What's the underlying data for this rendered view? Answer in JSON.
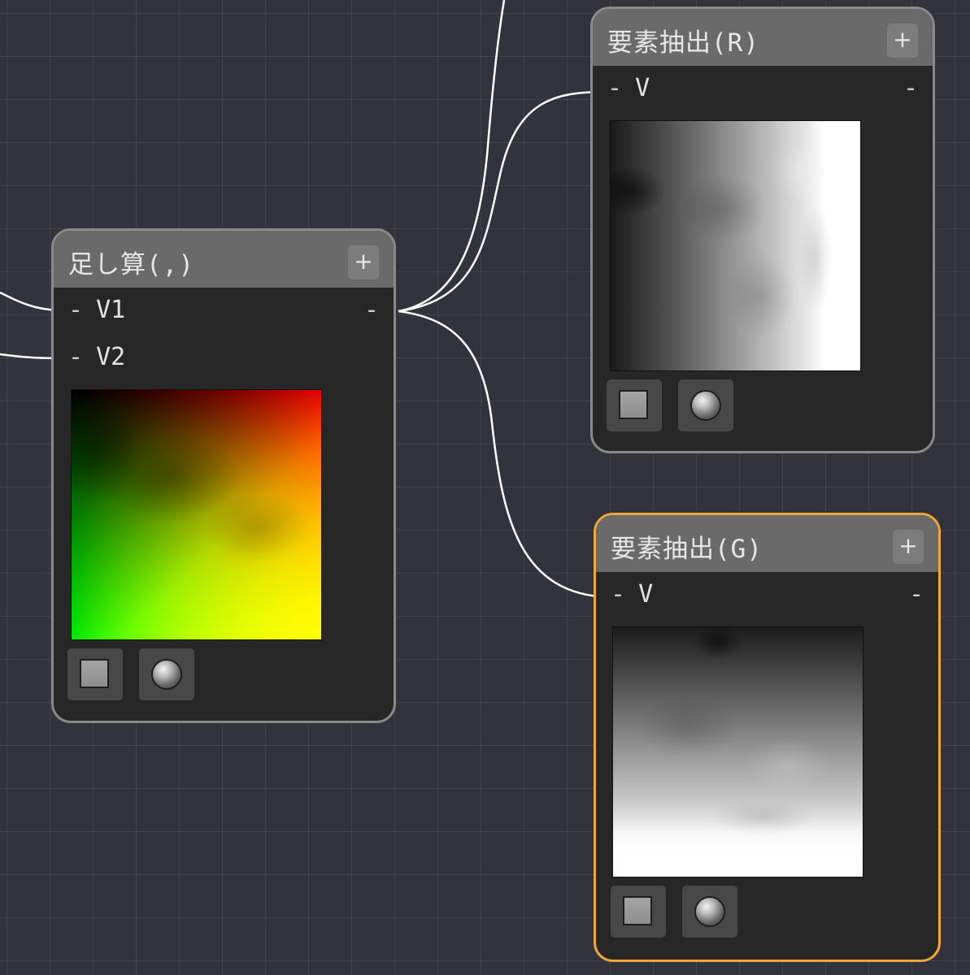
{
  "nodes": {
    "add": {
      "title": "足し算(,)",
      "add_label": "+",
      "inputs": [
        {
          "dash": "-",
          "label": "V1"
        },
        {
          "dash": "-",
          "label": "V2"
        }
      ],
      "output_dash": "-"
    },
    "extract_r": {
      "title": "要素抽出(R)",
      "add_label": "+",
      "input": {
        "dash": "-",
        "label": "V"
      },
      "output_dash": "-"
    },
    "extract_g": {
      "title": "要素抽出(G)",
      "add_label": "+",
      "input": {
        "dash": "-",
        "label": "V"
      },
      "output_dash": "-",
      "selected": true
    }
  },
  "colors": {
    "canvas_bg": "#33333d",
    "node_bg": "#272727",
    "header_bg": "#6a6a6a",
    "selection": "#f0a83a",
    "wire": "#ffffff"
  },
  "icons": {
    "preview_plane": "square-icon",
    "preview_sphere": "sphere-icon",
    "add": "plus-icon"
  }
}
